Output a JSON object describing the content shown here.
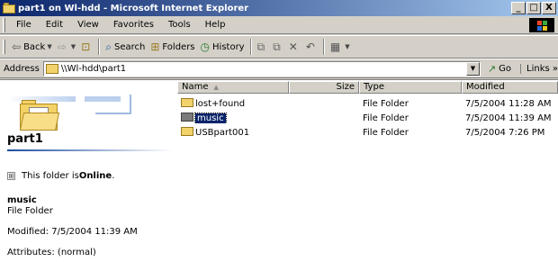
{
  "window": {
    "title": "part1 on Wl-hdd - Microsoft Internet Explorer",
    "controls": {
      "minimize": "_",
      "maximize": "□",
      "close": "X"
    }
  },
  "menu": [
    "File",
    "Edit",
    "View",
    "Favorites",
    "Tools",
    "Help"
  ],
  "toolbar": {
    "back": "Back",
    "search": "Search",
    "folders": "Folders",
    "history": "History"
  },
  "address": {
    "label": "Address",
    "value": "\\\\Wl-hdd\\part1",
    "go": "Go",
    "links": "Links"
  },
  "left_pane": {
    "title": "part1",
    "online_prefix": "This folder is ",
    "online_status": "Online",
    "online_suffix": ".",
    "selected_name": "music",
    "selected_type": "File Folder",
    "modified": "Modified: 7/5/2004 11:39 AM",
    "attributes": "Attributes: (normal)"
  },
  "columns": {
    "name": "Name",
    "size": "Size",
    "type": "Type",
    "modified": "Modified"
  },
  "files": [
    {
      "name": "lost+found",
      "size": "",
      "type": "File Folder",
      "modified": "7/5/2004 11:28 AM",
      "selected": false
    },
    {
      "name": "music",
      "size": "",
      "type": "File Folder",
      "modified": "7/5/2004 11:39 AM",
      "selected": true
    },
    {
      "name": "USBpart001",
      "size": "",
      "type": "File Folder",
      "modified": "7/5/2004 7:26 PM",
      "selected": false
    }
  ],
  "colors": {
    "titlebar": "#0a246a",
    "selection": "#0a246a",
    "chrome": "#d4d0c8"
  }
}
